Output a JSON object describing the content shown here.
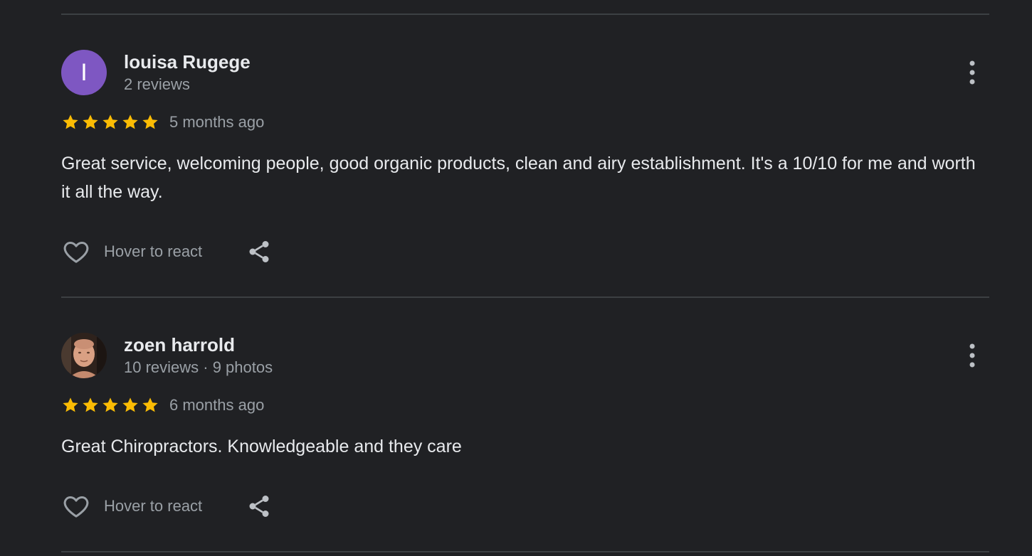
{
  "reviews": [
    {
      "avatar_letter": "I",
      "avatar_color": "#7e57c2",
      "name": "louisa Rugege",
      "meta": "2 reviews",
      "rating": 5,
      "time": "5 months ago",
      "text": "Great service, welcoming people, good organic products, clean and airy establishment. It's a 10/10 for me and worth it all the way.",
      "react_label": "Hover to react",
      "icons": {
        "react": "heart-icon",
        "share": "share-icon",
        "more": "more-vert-icon"
      }
    },
    {
      "avatar_letter": "",
      "name": "zoen harrold",
      "meta": "10 reviews · 9 photos",
      "rating": 5,
      "time": "6 months ago",
      "text": "Great Chiropractors. Knowledgeable and they care",
      "react_label": "Hover to react",
      "icons": {
        "react": "heart-icon",
        "share": "share-icon",
        "more": "more-vert-icon"
      }
    }
  ],
  "colors": {
    "background": "#202124",
    "star": "#fbbc04",
    "text_primary": "#e8eaed",
    "text_secondary": "#9aa0a6",
    "divider": "#3c4043"
  }
}
